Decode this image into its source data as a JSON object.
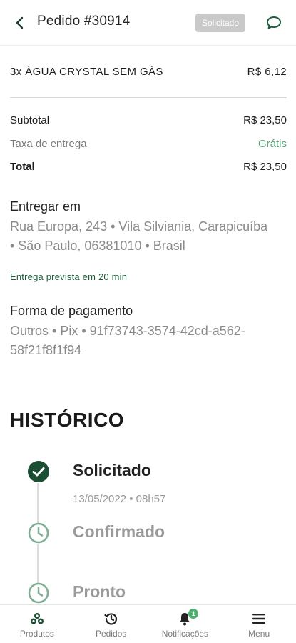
{
  "header": {
    "title": "Pedido #30914",
    "status_badge": "Solicitado"
  },
  "order": {
    "item": {
      "description": "3x ÁGUA CRYSTAL SEM GÁS",
      "price": "R$ 6,12"
    },
    "subtotal": {
      "label": "Subtotal",
      "value": "R$ 23,50"
    },
    "fee": {
      "label": "Taxa de entrega",
      "value": "Grátis"
    },
    "total": {
      "label": "Total",
      "value": "R$ 23,50"
    }
  },
  "delivery": {
    "heading": "Entregar em",
    "address_line1": "Rua Europa, 243 • Vila Silviania, Carapicuíba",
    "address_line2": "• São Paulo, 06381010 • Brasil",
    "estimate": "Entrega prevista em 20 min"
  },
  "payment": {
    "heading": "Forma de pagamento",
    "line1": "Outros • Pix • 91f73743-3574-42cd-a562-",
    "line2": "58f21f8f1f94"
  },
  "history": {
    "title": "HISTÓRICO",
    "steps": [
      {
        "label": "Solicitado",
        "date": "13/05/2022 • 08h57",
        "state": "done"
      },
      {
        "label": "Confirmado",
        "state": "pending"
      },
      {
        "label": "Pronto",
        "state": "pending"
      }
    ]
  },
  "bottom_nav": {
    "items": [
      {
        "label": "Produtos",
        "icon": "products-icon"
      },
      {
        "label": "Pedidos",
        "icon": "orders-history-icon"
      },
      {
        "label": "Notificações",
        "icon": "bell-icon",
        "badge": "1"
      },
      {
        "label": "Menu",
        "icon": "hamburger-menu-icon"
      }
    ]
  },
  "colors": {
    "brand_green": "#1b5e3b",
    "free_green": "#5aa37c",
    "badge_gray": "#c9c9c9"
  }
}
